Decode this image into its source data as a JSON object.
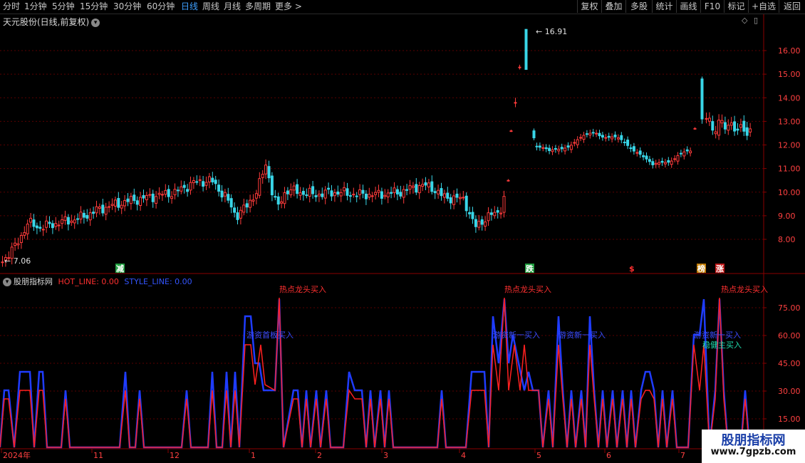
{
  "toolbar": {
    "periods": [
      "分时",
      "1分钟",
      "5分钟",
      "15分钟",
      "30分钟",
      "60分钟",
      "日线",
      "周线",
      "月线",
      "多周期",
      "更多 >"
    ],
    "active_period": "日线",
    "right_buttons": [
      "复权",
      "叠加",
      "多股",
      "统计",
      "画线",
      "F10",
      "标记",
      "+自选",
      "返回"
    ]
  },
  "main_chart": {
    "title": "天元股份(日线,前复权)",
    "high_label": "16.91",
    "low_label": "7.06",
    "y_ticks": [
      "16.00",
      "15.00",
      "14.00",
      "13.00",
      "12.00",
      "11.00",
      "10.00",
      "9.00",
      "8.00"
    ],
    "markers": [
      "减",
      "跌",
      "$",
      "榜",
      "涨"
    ]
  },
  "indicator": {
    "name": "股朋指标网",
    "hot_line": "HOT_LINE: 0.00",
    "style_line": "STYLE_LINE: 0.00",
    "y_ticks": [
      "75.00",
      "60.00",
      "45.00",
      "30.00",
      "15.00"
    ],
    "signals": {
      "top": "热点龙头买入",
      "mid_a": "游资首板买入",
      "mid_b": "游资新一买入",
      "mid_c": "游资新一买入",
      "mid_d": "游资新一买入",
      "stable": "稳健主买入"
    }
  },
  "x_axis": [
    "2024年",
    "11",
    "12",
    "1",
    "2",
    "3",
    "4",
    "5",
    "6",
    "7"
  ],
  "watermark": {
    "name": "股朋指标网",
    "url": "www.7gpzb.com"
  },
  "colors": {
    "up": "#ff3b3b",
    "down": "#39d6e8",
    "hot": "#ff2020",
    "style": "#1f3cff",
    "grid": "#5a0000"
  },
  "chart_data": {
    "type": "candlestick",
    "price_range": [
      7.06,
      16.91
    ],
    "indicator_range": [
      0,
      85
    ]
  }
}
